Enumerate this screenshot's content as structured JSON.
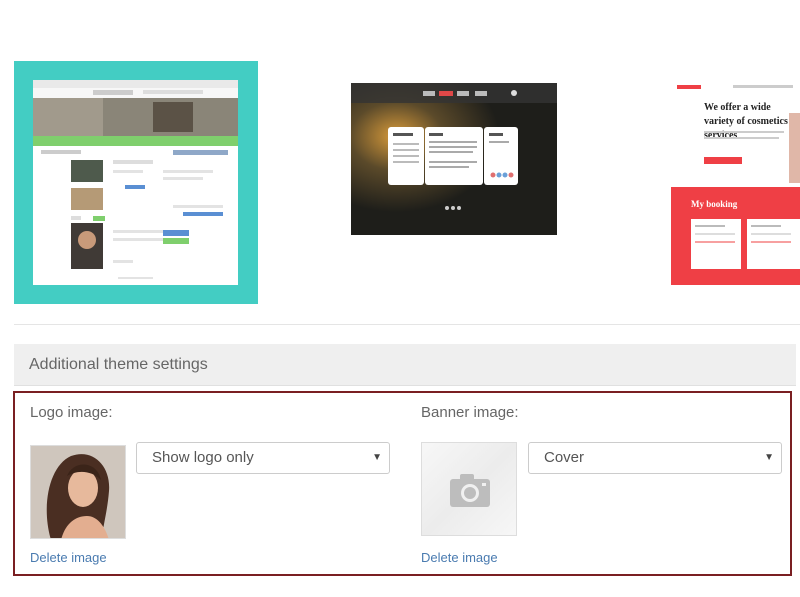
{
  "themes": [
    {
      "name": "theme-classic",
      "selected": true
    },
    {
      "name": "theme-dark",
      "selected": false
    },
    {
      "name": "theme-cosmetics",
      "selected": false,
      "headline": "We offer a wide variety of cosmetics services",
      "booking_title": "My booking"
    }
  ],
  "settings": {
    "header": "Additional theme settings",
    "logo": {
      "label": "Logo image:",
      "select_value": "Show logo only",
      "delete_label": "Delete image"
    },
    "banner": {
      "label": "Banner image:",
      "select_value": "Cover",
      "delete_label": "Delete image"
    }
  },
  "colors": {
    "selected_border": "#43cdc3",
    "panel_border": "#7a1f22",
    "link": "#4a7bb0",
    "cosmetics_red": "#ef3f45"
  }
}
